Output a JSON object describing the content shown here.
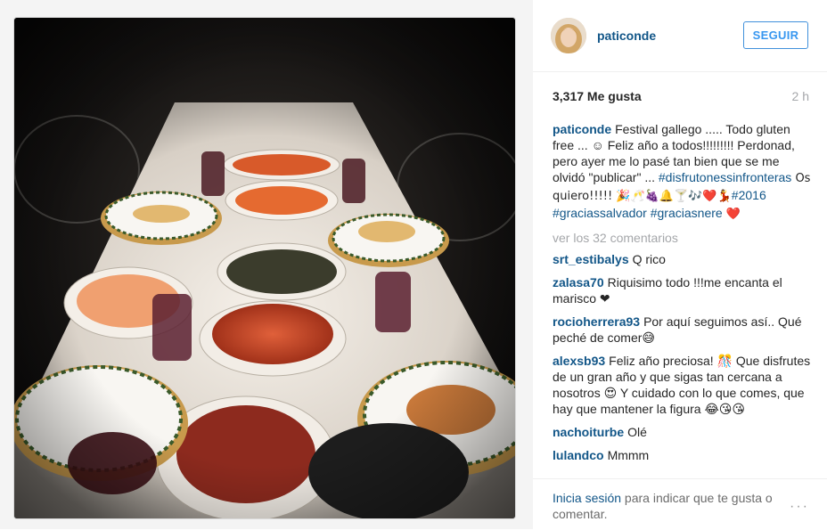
{
  "post": {
    "username": "paticonde",
    "follow_label": "SEGUIR",
    "likes": "3,317 Me gusta",
    "time_ago": "2 h"
  },
  "caption": {
    "user": "paticonde",
    "text_1": "Festival gallego ..... Todo gluten free ... ☺ Feliz año a todos!!!!!!!!! Perdonad, pero ayer me lo pasé tan bien que se me olvidó \"publicar\" ... ",
    "tag_1": "#disfrutonessinfronteras",
    "text_2": " Os quiero!!!!! 🎉🥂🍇🔔🍸🎶❤️💃",
    "tag_2": "#2016",
    "tag_3": "#graciassalvador",
    "tag_4": "#graciasnere",
    "text_3": " ❤️"
  },
  "view_more": "ver los 32 comentarios",
  "comments": [
    {
      "user": "srt_estibalys",
      "text": "Q rico"
    },
    {
      "user": "zalasa70",
      "text": "Riquisimo todo !!!me encanta el marisco ❤"
    },
    {
      "user": "rocioherrera93",
      "text": "Por aquí seguimos así.. Qué peché de comer😅"
    },
    {
      "user": "alexsb93",
      "text": "Feliz año preciosa! 🎊 Que disfrutes de un gran año y que sigas tan cercana a nosotros 😍 Y cuidado con lo que comes, que hay que mantener la figura 😂😘😘"
    },
    {
      "user": "nachoiturbe",
      "text": "Olé"
    },
    {
      "user": "lulandco",
      "text": "Mmmm"
    }
  ],
  "footer": {
    "login_link": "Inicia sesión",
    "login_rest": " para indicar que te gusta o comentar.",
    "more_icon": "···"
  },
  "colors": {
    "link": "#125688",
    "button": "#3897f0",
    "muted": "#a5a7aa"
  }
}
